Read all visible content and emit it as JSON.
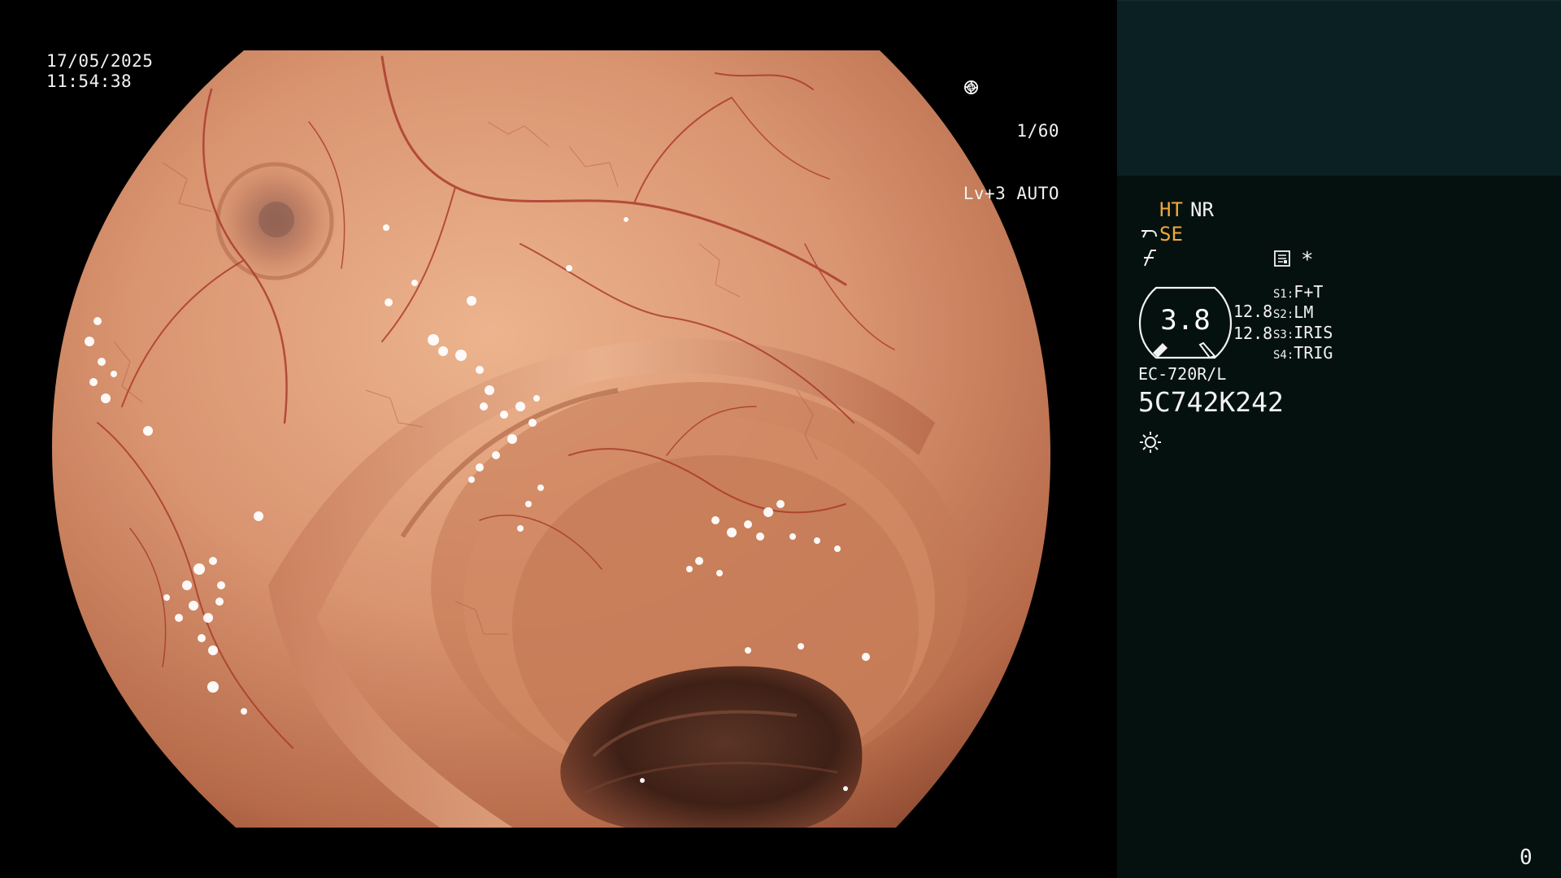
{
  "osd": {
    "date": "17/05/2025",
    "time": "11:54:38",
    "shutter": "1/60",
    "shutter_icon": "aperture-icon",
    "iris_mode": "Lv+3 AUTO",
    "iris_icon": "iris-icon"
  },
  "panel": {
    "ht": "HT",
    "nr": "NR",
    "se_icon": "scope-bend-icon",
    "se": "SE",
    "f_icon": "enhancement-f-icon",
    "memo_icon": "memo-icon",
    "asterisk": "*",
    "gauge_value": "3.8",
    "value_a": "12.8",
    "value_b": "12.8",
    "switches": [
      {
        "key": "S1:",
        "value": "F+T"
      },
      {
        "key": "S2:",
        "value": "LM"
      },
      {
        "key": "S3:",
        "value": "IRIS"
      },
      {
        "key": "S4:",
        "value": "TRIG"
      }
    ],
    "scope_model": "EC-720R/L",
    "scope_serial": "5C742K242",
    "light_icon": "light-sun-icon",
    "counter": "0"
  },
  "colors": {
    "accent_orange": "#f2a73a",
    "panel_bg": "#05110f",
    "thumb_bg": "#0b2022",
    "mucosa": "#d8926c",
    "vessel": "#a8362a"
  }
}
